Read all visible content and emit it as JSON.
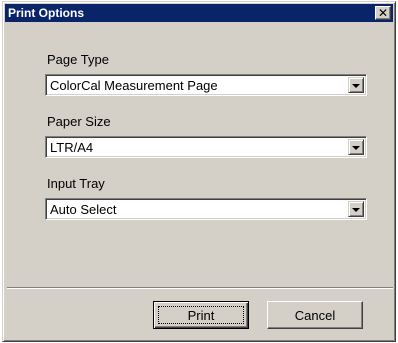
{
  "dialog": {
    "title": "Print Options",
    "close_symbol": "✕"
  },
  "fields": {
    "page_type": {
      "label": "Page Type",
      "value": "ColorCal Measurement Page"
    },
    "paper_size": {
      "label": "Paper Size",
      "value": "LTR/A4"
    },
    "input_tray": {
      "label": "Input Tray",
      "value": "Auto Select"
    }
  },
  "buttons": {
    "print": "Print",
    "cancel": "Cancel"
  },
  "colors": {
    "titlebar": "#0a246a",
    "face": "#d4d0c8"
  }
}
